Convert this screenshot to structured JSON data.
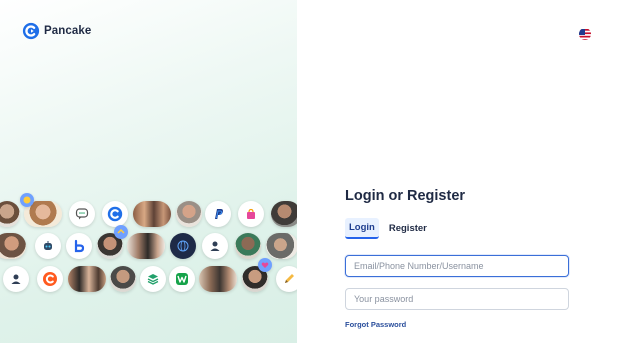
{
  "brand": {
    "name": "Pancake"
  },
  "login": {
    "title": "Login or Register",
    "tabs": [
      "Login",
      "Register"
    ],
    "active_tab": "Login",
    "username_placeholder": "Email/Phone Number/Username",
    "password_placeholder": "Your password",
    "forgot_password": "Forgot Password"
  },
  "language": {
    "flag": "us-flag-icon"
  },
  "colors": {
    "accent": "#2563eb",
    "brand": "#1f6fe8",
    "text": "#1f2a44",
    "link": "#2b4f9c"
  }
}
